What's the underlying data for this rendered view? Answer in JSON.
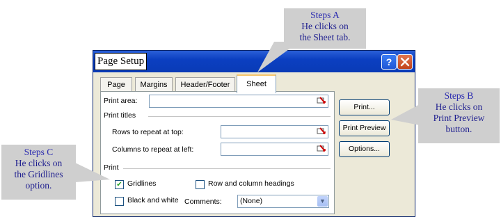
{
  "dialog": {
    "title": "Page Setup",
    "help_button": "?",
    "close_button": "X",
    "tabs": [
      {
        "label": "Page"
      },
      {
        "label": "Margins"
      },
      {
        "label": "Header/Footer"
      },
      {
        "label": "Sheet",
        "active": true
      }
    ],
    "sheet": {
      "print_area_label": "Print area:",
      "print_area_value": "",
      "print_titles_label": "Print titles",
      "rows_repeat_label": "Rows to repeat at top:",
      "rows_repeat_value": "",
      "cols_repeat_label": "Columns to repeat at left:",
      "cols_repeat_value": "",
      "print_label": "Print",
      "gridlines_label": "Gridlines",
      "gridlines_checked": true,
      "black_white_label": "Black and white",
      "black_white_checked": false,
      "row_col_headings_label": "Row and column headings",
      "row_col_headings_checked": false,
      "comments_label": "Comments:",
      "comments_value": "(None)"
    },
    "buttons": {
      "print": "Print...",
      "print_preview": "Print Preview",
      "options": "Options..."
    }
  },
  "callouts": {
    "a": {
      "head": "Steps A",
      "line1": "He clicks on",
      "line2": "the Sheet tab."
    },
    "b": {
      "head": "Steps B",
      "line1": "He clicks on",
      "line2": "Print Preview",
      "line3": "button."
    },
    "c": {
      "head": "Steps C",
      "line1": "He clicks on",
      "line2": "the Gridlines",
      "line3": "option."
    }
  },
  "colors": {
    "titlebar": "#0b3fc1",
    "dialog_face": "#ece9d8",
    "callout_shadow": "#cfcfcf",
    "callout_text": "#1f1f8f"
  }
}
